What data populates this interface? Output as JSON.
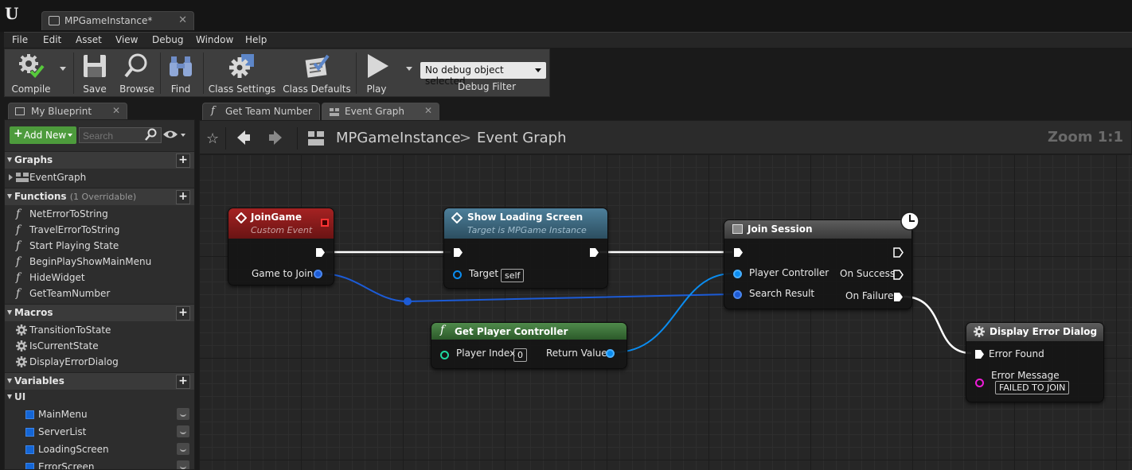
{
  "document_tab": {
    "label": "MPGameInstance*"
  },
  "menu": [
    "File",
    "Edit",
    "Asset",
    "View",
    "Debug",
    "Window",
    "Help"
  ],
  "toolbar": {
    "compile": "Compile",
    "save": "Save",
    "browse": "Browse",
    "find": "Find",
    "class_settings": "Class Settings",
    "class_defaults": "Class Defaults",
    "play": "Play",
    "debug_object": "No debug object selected",
    "debug_filter": "Debug Filter"
  },
  "my_blueprint": {
    "tab_label": "My Blueprint",
    "add_new": "Add New",
    "search_placeholder": "Search",
    "graphs": {
      "title": "Graphs",
      "items": [
        "EventGraph"
      ]
    },
    "functions": {
      "title": "Functions",
      "subtitle": "(1 Overridable)",
      "items": [
        "NetErrorToString",
        "TravelErrorToString",
        "Start Playing State",
        "BeginPlayShowMainMenu",
        "HideWidget",
        "GetTeamNumber"
      ]
    },
    "macros": {
      "title": "Macros",
      "items": [
        "TransitionToState",
        "IsCurrentState",
        "DisplayErrorDialog"
      ]
    },
    "variables": {
      "title": "Variables",
      "category": "UI",
      "items": [
        "MainMenu",
        "ServerList",
        "LoadingScreen",
        "ErrorScreen"
      ],
      "color": "#1466d6"
    }
  },
  "graph_tabs": [
    {
      "label": "Get Team Number"
    },
    {
      "label": "Event Graph"
    }
  ],
  "graph_header": {
    "breadcrumb_root": "MPGameInstance",
    "breadcrumb_sep": ">",
    "breadcrumb_leaf": "Event Graph",
    "zoom": "Zoom 1:1"
  },
  "nodes": {
    "join_game": {
      "title": "JoinGame",
      "subtitle": "Custom Event",
      "pin_game_to_join": "Game to Join",
      "color": "#8f1c1c"
    },
    "show_loading": {
      "title": "Show Loading Screen",
      "subtitle": "Target is MPGame Instance",
      "pin_target": "Target",
      "target_value": "self",
      "color": "#3d6f8a"
    },
    "get_player_controller": {
      "title": "Get Player Controller",
      "pin_player_index": "Player Index",
      "player_index_value": "0",
      "pin_return": "Return Value",
      "color": "#3c6b3a"
    },
    "join_session": {
      "title": "Join Session",
      "pin_player_controller": "Player Controller",
      "pin_search_result": "Search Result",
      "pin_on_success": "On Success",
      "pin_on_failure": "On Failure"
    },
    "display_error": {
      "title": "Display Error Dialog",
      "pin_error_found": "Error Found",
      "pin_error_message": "Error Message",
      "error_message_value": "FAILED TO JOIN"
    }
  },
  "colors": {
    "object_pin": "#0a8cf0",
    "struct_pin": "#1c5bd6",
    "int_pin": "#1fd8a0",
    "string_pin": "#ee1cd8",
    "exec": "#ffffff"
  }
}
